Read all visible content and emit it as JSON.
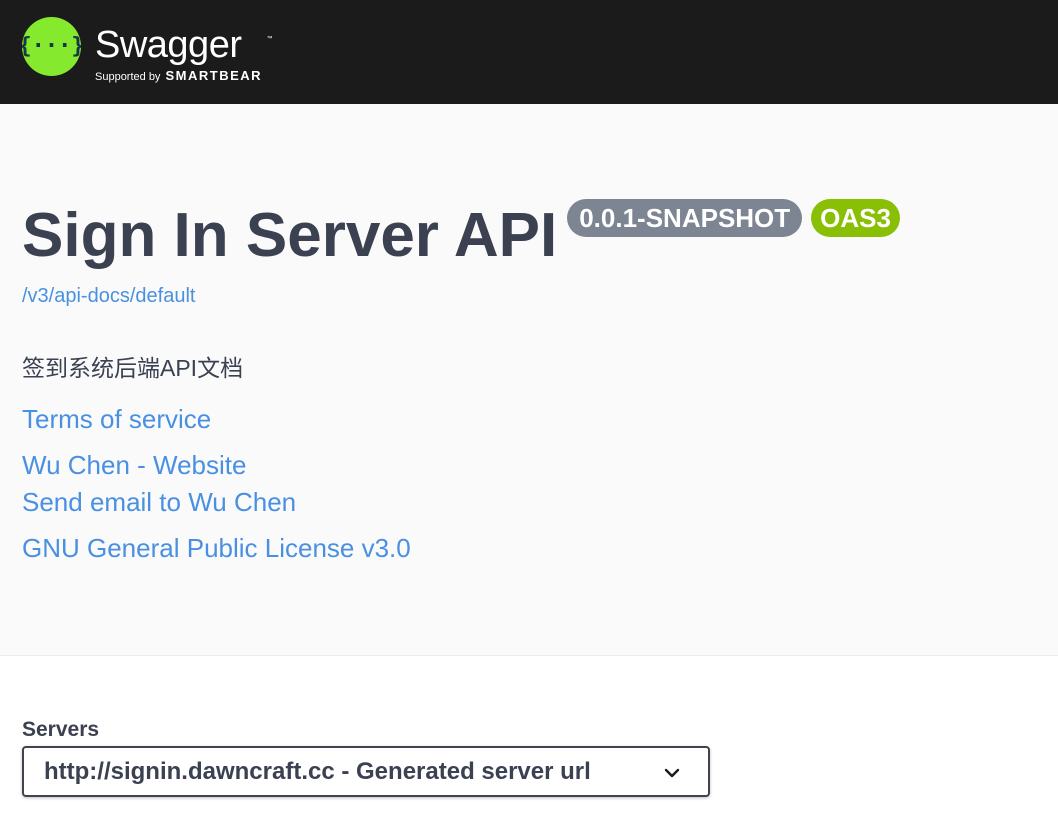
{
  "header": {
    "logo_name": "Swagger",
    "logo_tm": "™",
    "logo_sub_prefix": "Supported by",
    "logo_sub_brand": "SMARTBEAR",
    "logo_color": "#85ea2d",
    "background": "#1b1b1b"
  },
  "info": {
    "title": "Sign In Server API",
    "version_badge": "0.0.1-SNAPSHOT",
    "oas_badge": "OAS3",
    "spec_url": "/v3/api-docs/default",
    "description": "签到系统后端API文档",
    "links": {
      "terms": "Terms of service",
      "website": "Wu Chen - Website",
      "email": "Send email to Wu Chen",
      "license": "GNU General Public License v3.0"
    },
    "colors": {
      "link": "#4990e2",
      "version_badge": "#7d8492",
      "oas_badge": "#89bf04"
    }
  },
  "servers": {
    "label": "Servers",
    "selected": "http://signin.dawncraft.cc - Generated server url",
    "dropdown_icon": "chevron-down-icon"
  }
}
